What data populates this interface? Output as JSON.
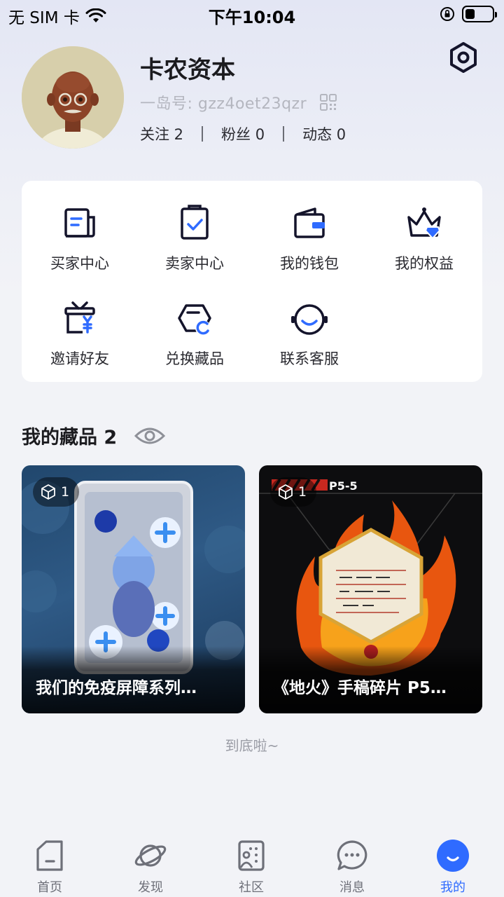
{
  "status_bar": {
    "carrier": "无 SIM 卡",
    "time": "下午10:04",
    "battery_level_percent": 35
  },
  "profile": {
    "username": "卡农资本",
    "island_id": "一岛号: gzz4oet23qzr",
    "stats": [
      {
        "label": "关注 2"
      },
      {
        "label": "粉丝 0"
      },
      {
        "label": "动态 0"
      }
    ]
  },
  "menu": {
    "items": [
      {
        "label": "买家中心",
        "icon": "buyer-center-icon"
      },
      {
        "label": "卖家中心",
        "icon": "seller-center-icon"
      },
      {
        "label": "我的钱包",
        "icon": "wallet-icon"
      },
      {
        "label": "我的权益",
        "icon": "crown-icon"
      },
      {
        "label": "邀请好友",
        "icon": "gift-icon"
      },
      {
        "label": "兑换藏品",
        "icon": "exchange-icon"
      },
      {
        "label": "联系客服",
        "icon": "headset-icon"
      }
    ]
  },
  "collection": {
    "title": "我的藏品 2",
    "items": [
      {
        "title": "我们的免疫屏障系列…",
        "count": "1",
        "tag": ""
      },
      {
        "title": "《地火》手稿碎片 P5…",
        "count": "1",
        "tag": "P5-5"
      }
    ],
    "end_text": "到底啦~"
  },
  "tabs": [
    {
      "label": "首页",
      "icon": "home-icon",
      "active": false
    },
    {
      "label": "发现",
      "icon": "planet-icon",
      "active": false
    },
    {
      "label": "社区",
      "icon": "community-icon",
      "active": false
    },
    {
      "label": "消息",
      "icon": "message-icon",
      "active": false
    },
    {
      "label": "我的",
      "icon": "profile-icon",
      "active": true
    }
  ],
  "colors": {
    "accent": "#2f6bff",
    "text_primary": "#1b1b1f",
    "background": "#f2f3f7"
  }
}
